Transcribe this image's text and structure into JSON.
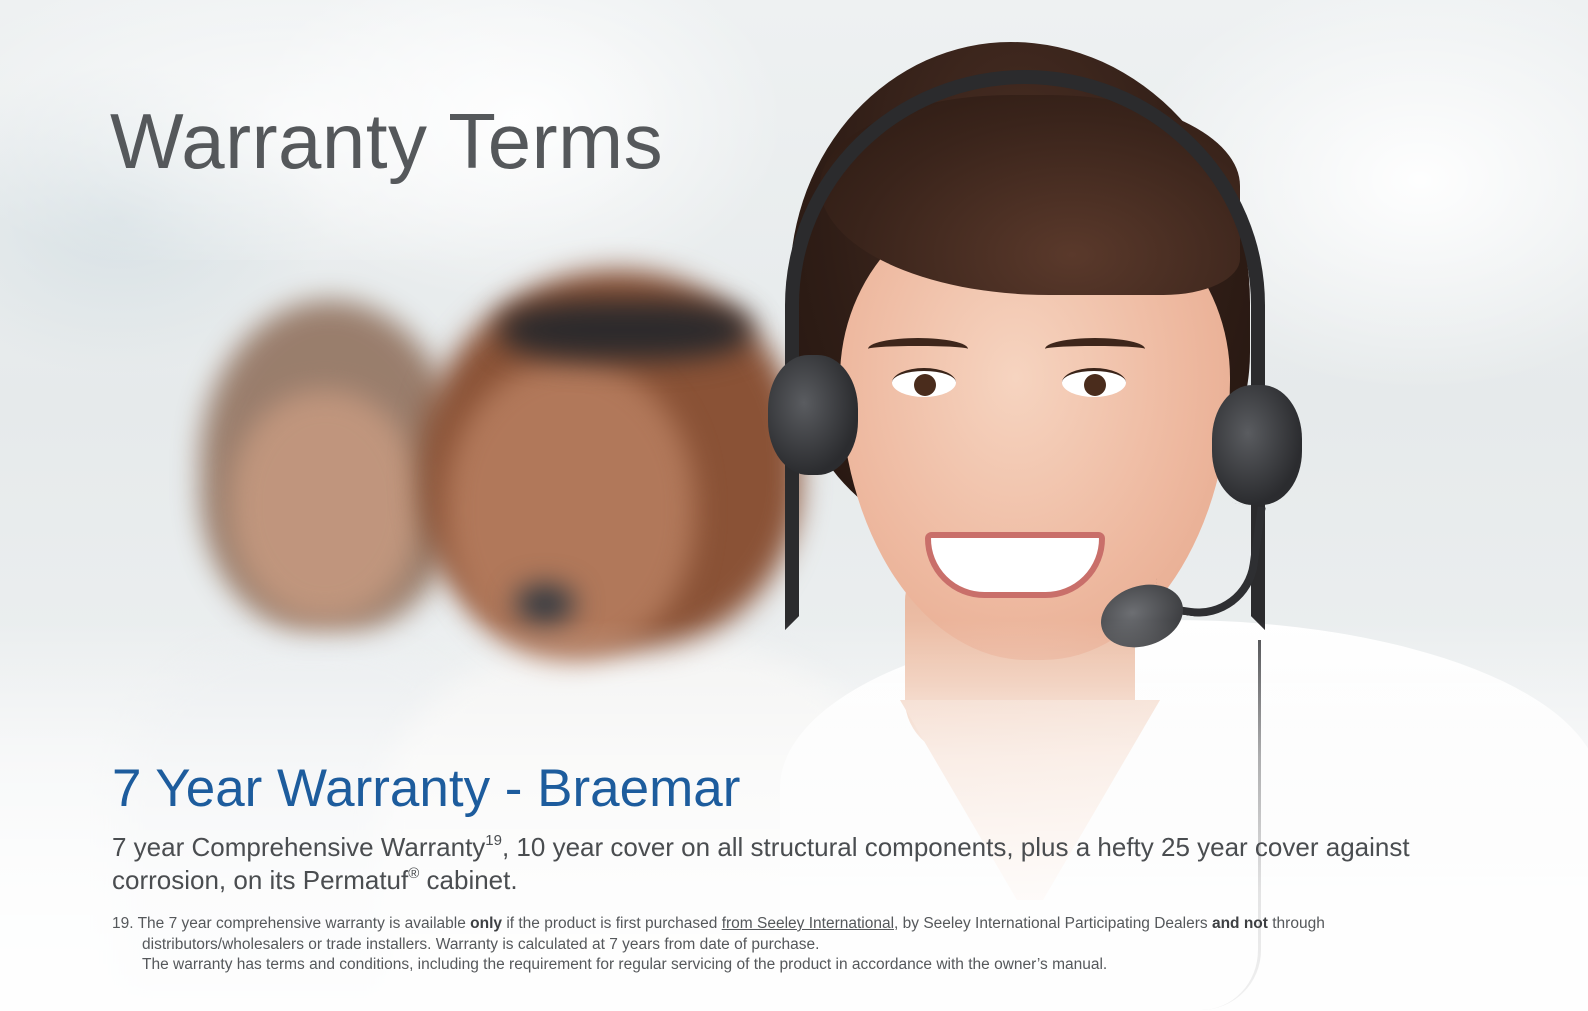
{
  "page": {
    "title": "Warranty Terms"
  },
  "section": {
    "heading": "7 Year Warranty - Braemar",
    "intro_part1": "7 year Comprehensive Warranty",
    "intro_sup": "19",
    "intro_part2": ", 10 year cover on all structural components, plus a hefty 25 year cover against corrosion, on its Permatuf",
    "intro_reg": "®",
    "intro_part3": " cabinet."
  },
  "footnote": {
    "number": "19.",
    "l1_a": "The 7 year comprehensive warranty is available ",
    "l1_only": "only",
    "l1_b": " if the product is first purchased ",
    "l1_link": "from Seeley International",
    "l1_c": ", by Seeley International Participating Dealers ",
    "l1_andnot": "and not",
    "l1_d": " through",
    "l2": "distributors/wholesalers or trade installers. Warranty is calculated at 7 years from date of purchase.",
    "l3": "The warranty has terms and conditions, including the requirement for regular servicing of the product in accordance with the owner’s manual."
  },
  "colors": {
    "title": "#55585b",
    "heading_blue": "#1d5c9d",
    "body_text": "#4a4d50"
  }
}
